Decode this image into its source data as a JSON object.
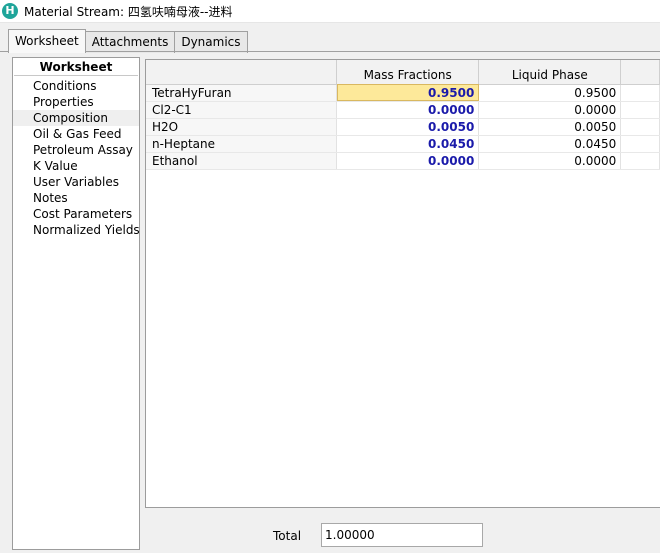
{
  "window": {
    "title": "Material Stream: 四氢呋喃母液--进料",
    "icon": "hysys-app-icon"
  },
  "tabs": [
    {
      "label": "Worksheet",
      "active": true
    },
    {
      "label": "Attachments",
      "active": false
    },
    {
      "label": "Dynamics",
      "active": false
    }
  ],
  "nav": {
    "header": "Worksheet",
    "items": [
      {
        "label": "Conditions"
      },
      {
        "label": "Properties"
      },
      {
        "label": "Composition",
        "selected": true
      },
      {
        "label": "Oil & Gas Feed"
      },
      {
        "label": "Petroleum Assay"
      },
      {
        "label": "K Value"
      },
      {
        "label": "User Variables"
      },
      {
        "label": "Notes"
      },
      {
        "label": "Cost Parameters"
      },
      {
        "label": "Normalized Yields"
      }
    ]
  },
  "grid": {
    "columns": [
      "",
      "Mass Fractions",
      "Liquid Phase",
      ""
    ],
    "rows": [
      {
        "component": "TetraHyFuran",
        "mass": "0.9500",
        "liquid": "0.9500",
        "selected": true
      },
      {
        "component": "Cl2-C1",
        "mass": "0.0000",
        "liquid": "0.0000"
      },
      {
        "component": "H2O",
        "mass": "0.0050",
        "liquid": "0.0050"
      },
      {
        "component": "n-Heptane",
        "mass": "0.0450",
        "liquid": "0.0450"
      },
      {
        "component": "Ethanol",
        "mass": "0.0000",
        "liquid": "0.0000"
      }
    ]
  },
  "total": {
    "label": "Total",
    "value": "1.00000"
  }
}
